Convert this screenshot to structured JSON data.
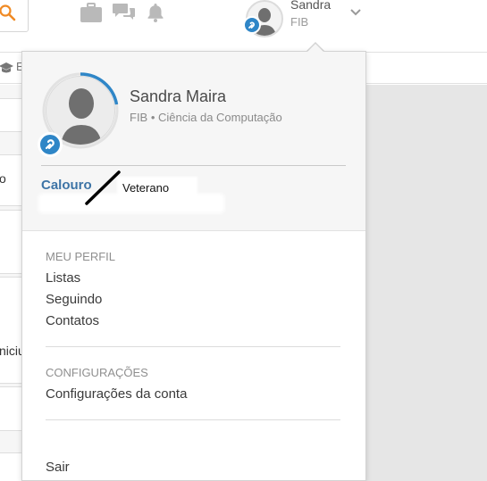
{
  "topbar": {
    "user_name": "Sandra",
    "user_org": "FIB",
    "icons": [
      "search-icon",
      "briefcase-icon",
      "chat-icon",
      "bell-icon",
      "chevron-down-icon"
    ]
  },
  "subbar": {
    "partial_label": "E",
    "icon": "graduation-cap-icon"
  },
  "left_panel": {
    "partial_1": "o",
    "partial_2": "niciu"
  },
  "profile": {
    "name": "Sandra Maira",
    "subtitle": "FIB • Ciência da Computação",
    "level_current": "Calouro",
    "level_next": "Veterano",
    "accent_color": "#2f86c7",
    "level_color": "#3d74a6"
  },
  "menu": {
    "sections": [
      {
        "title": "MEU PERFIL",
        "items": [
          "Listas",
          "Seguindo",
          "Contatos"
        ]
      },
      {
        "title": "CONFIGURAÇÕES",
        "items": [
          "Configurações da conta"
        ]
      }
    ],
    "logout": "Sair"
  }
}
